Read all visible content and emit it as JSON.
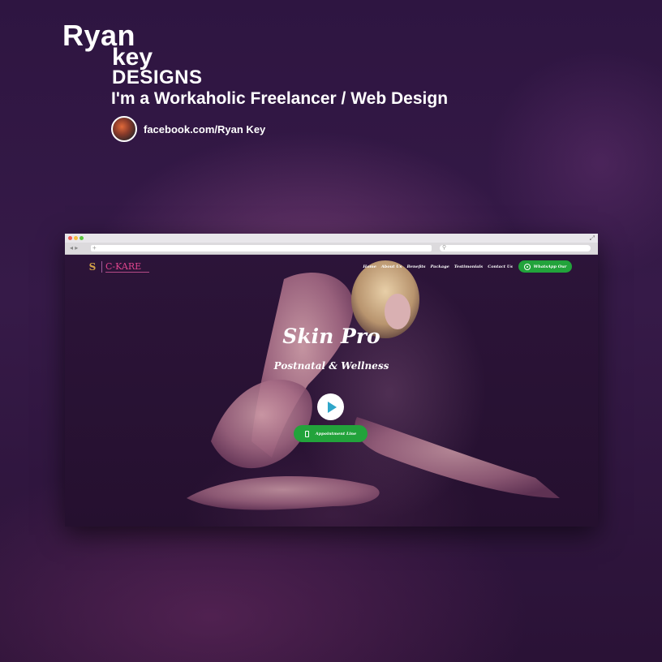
{
  "brand": {
    "line1": "Ryan",
    "line2": "key",
    "line3": "DESIGNS",
    "tagline": "I'm a Workaholic Freelancer / Web Design",
    "facebook": "facebook.com/Ryan Key"
  },
  "browser": {
    "new_tab_glyph": "+",
    "nav_arrows": "◂ ▸",
    "search_glyph": "⚲",
    "maximize_glyph": "⤢"
  },
  "site": {
    "logo_text": "C-KARE",
    "logo_emblem": "S",
    "nav": [
      "Home",
      "About Us",
      "Benefits",
      "Package",
      "Testimonials",
      "Contact Us"
    ],
    "whatsapp_label": "WhatsApp Our",
    "hero_title": "Skin Pro",
    "hero_subtitle": "Postnatal & Wellness",
    "appointment_label": "Appointment Line"
  },
  "colors": {
    "accent_green": "#22a33b",
    "logo_pink": "#e0458e",
    "logo_gold": "#d4a247",
    "background": "#2e1541"
  },
  "icons": [
    "profile-avatar",
    "whatsapp-icon",
    "play-icon",
    "phone-icon",
    "search-icon"
  ]
}
